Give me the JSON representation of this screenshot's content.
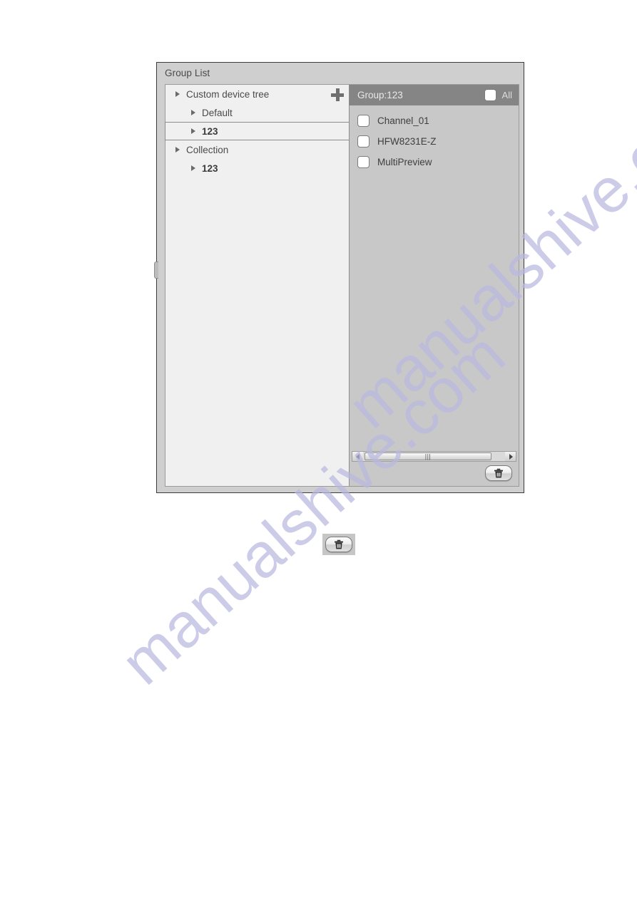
{
  "panel": {
    "title": "Group List"
  },
  "tree": {
    "add_button_name": "plus-icon",
    "items": [
      {
        "label": "Custom device tree",
        "level": 0,
        "selected": false,
        "bold": false
      },
      {
        "label": "Default",
        "level": 1,
        "selected": false,
        "bold": false
      },
      {
        "label": "123",
        "level": 1,
        "selected": true,
        "bold": true
      },
      {
        "label": "Collection",
        "level": 0,
        "selected": false,
        "bold": false
      },
      {
        "label": "123",
        "level": 1,
        "selected": false,
        "bold": true
      }
    ]
  },
  "device_pane": {
    "header_title": "Group:123",
    "all_label": "All",
    "all_checked": false,
    "items": [
      {
        "label": "Channel_01",
        "checked": false
      },
      {
        "label": "HFW8231E-Z",
        "checked": false
      },
      {
        "label": "MultiPreview",
        "checked": false
      }
    ],
    "scrollbar": {
      "left_arrow": "◀",
      "right_arrow": "▶",
      "grip": "|||"
    },
    "delete_button_name": "trash-icon"
  },
  "standalone_button": {
    "name": "trash-icon"
  },
  "watermark": {
    "line1": "manualshive.com",
    "line2": "manualshive.com"
  },
  "colors": {
    "panel_background": "#cfcfcf",
    "panel_border": "#3b3b3b",
    "tree_background": "#f0f0f0",
    "device_background": "#c8c8c8",
    "device_header": "#858585",
    "text": "#4a4a4a",
    "header_text": "#e9e9e9",
    "watermark": "#b9b9e0"
  }
}
